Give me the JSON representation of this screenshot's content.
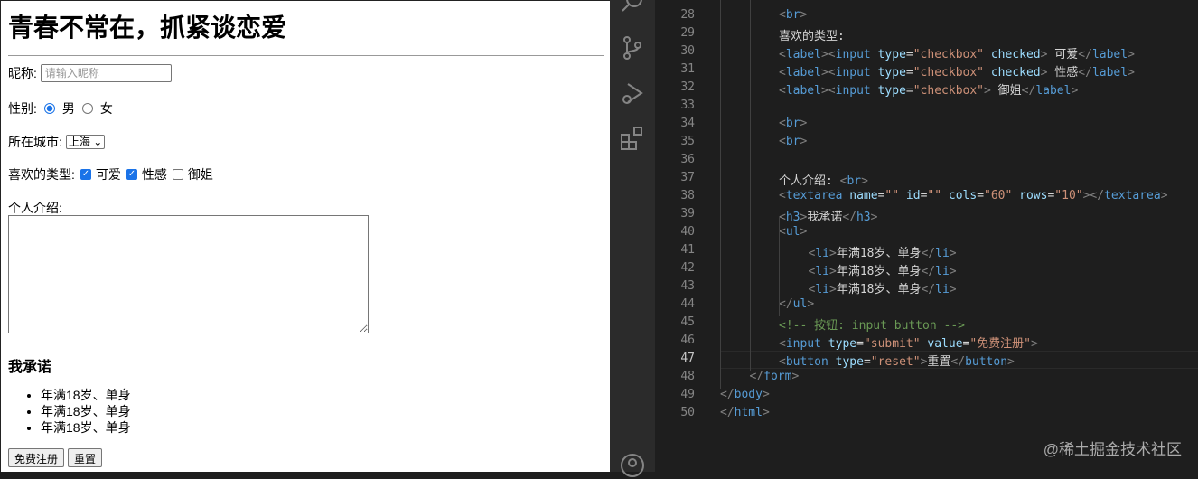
{
  "preview": {
    "title": "青春不常在，抓紧谈恋爱",
    "nickname_label": "昵称:",
    "nickname_placeholder": "请输入昵称",
    "gender_label": "性别:",
    "gender_options": [
      "男",
      "女"
    ],
    "gender_selected": "男",
    "city_label": "所在城市:",
    "city_value": "上海",
    "type_label": "喜欢的类型:",
    "types": [
      {
        "label": "可爱",
        "checked": true
      },
      {
        "label": "性感",
        "checked": true
      },
      {
        "label": "御姐",
        "checked": false
      }
    ],
    "intro_label": "个人介绍:",
    "promise_heading": "我承诺",
    "promises": [
      "年满18岁、单身",
      "年满18岁、单身",
      "年满18岁、单身"
    ],
    "submit_label": "免费注册",
    "reset_label": "重置"
  },
  "editor": {
    "current_line": 47,
    "lines": [
      {
        "n": 28,
        "indent": 2,
        "tokens": [
          [
            "p",
            "<"
          ],
          [
            "t",
            "br"
          ],
          [
            "p",
            ">"
          ]
        ]
      },
      {
        "n": 29,
        "indent": 2,
        "tokens": [
          [
            "x",
            "喜欢的类型:"
          ]
        ]
      },
      {
        "n": 30,
        "indent": 2,
        "tokens": [
          [
            "p",
            "<"
          ],
          [
            "t",
            "label"
          ],
          [
            "p",
            "><"
          ],
          [
            "t",
            "input"
          ],
          [
            "x",
            " "
          ],
          [
            "a",
            "type"
          ],
          [
            "x",
            "="
          ],
          [
            "s",
            "\"checkbox\""
          ],
          [
            "x",
            " "
          ],
          [
            "a",
            "checked"
          ],
          [
            "p",
            ">"
          ],
          [
            "x",
            " 可爱"
          ],
          [
            "p",
            "</"
          ],
          [
            "t",
            "label"
          ],
          [
            "p",
            ">"
          ]
        ]
      },
      {
        "n": 31,
        "indent": 2,
        "tokens": [
          [
            "p",
            "<"
          ],
          [
            "t",
            "label"
          ],
          [
            "p",
            "><"
          ],
          [
            "t",
            "input"
          ],
          [
            "x",
            " "
          ],
          [
            "a",
            "type"
          ],
          [
            "x",
            "="
          ],
          [
            "s",
            "\"checkbox\""
          ],
          [
            "x",
            " "
          ],
          [
            "a",
            "checked"
          ],
          [
            "p",
            ">"
          ],
          [
            "x",
            " 性感"
          ],
          [
            "p",
            "</"
          ],
          [
            "t",
            "label"
          ],
          [
            "p",
            ">"
          ]
        ]
      },
      {
        "n": 32,
        "indent": 2,
        "tokens": [
          [
            "p",
            "<"
          ],
          [
            "t",
            "label"
          ],
          [
            "p",
            "><"
          ],
          [
            "t",
            "input"
          ],
          [
            "x",
            " "
          ],
          [
            "a",
            "type"
          ],
          [
            "x",
            "="
          ],
          [
            "s",
            "\"checkbox\""
          ],
          [
            "p",
            ">"
          ],
          [
            "x",
            " 御姐"
          ],
          [
            "p",
            "</"
          ],
          [
            "t",
            "label"
          ],
          [
            "p",
            ">"
          ]
        ]
      },
      {
        "n": 33,
        "indent": 2,
        "tokens": []
      },
      {
        "n": 34,
        "indent": 2,
        "tokens": [
          [
            "p",
            "<"
          ],
          [
            "t",
            "br"
          ],
          [
            "p",
            ">"
          ]
        ]
      },
      {
        "n": 35,
        "indent": 2,
        "tokens": [
          [
            "p",
            "<"
          ],
          [
            "t",
            "br"
          ],
          [
            "p",
            ">"
          ]
        ]
      },
      {
        "n": 36,
        "indent": 2,
        "tokens": []
      },
      {
        "n": 37,
        "indent": 2,
        "tokens": [
          [
            "x",
            "个人介绍: "
          ],
          [
            "p",
            "<"
          ],
          [
            "t",
            "br"
          ],
          [
            "p",
            ">"
          ]
        ]
      },
      {
        "n": 38,
        "indent": 2,
        "tokens": [
          [
            "p",
            "<"
          ],
          [
            "t",
            "textarea"
          ],
          [
            "x",
            " "
          ],
          [
            "a",
            "name"
          ],
          [
            "x",
            "="
          ],
          [
            "s",
            "\"\""
          ],
          [
            "x",
            " "
          ],
          [
            "a",
            "id"
          ],
          [
            "x",
            "="
          ],
          [
            "s",
            "\"\""
          ],
          [
            "x",
            " "
          ],
          [
            "a",
            "cols"
          ],
          [
            "x",
            "="
          ],
          [
            "s",
            "\"60\""
          ],
          [
            "x",
            " "
          ],
          [
            "a",
            "rows"
          ],
          [
            "x",
            "="
          ],
          [
            "s",
            "\"10\""
          ],
          [
            "p",
            "></"
          ],
          [
            "t",
            "textarea"
          ],
          [
            "p",
            ">"
          ]
        ]
      },
      {
        "n": 39,
        "indent": 2,
        "tokens": [
          [
            "p",
            "<"
          ],
          [
            "t",
            "h3"
          ],
          [
            "p",
            ">"
          ],
          [
            "x",
            "我承诺"
          ],
          [
            "p",
            "</"
          ],
          [
            "t",
            "h3"
          ],
          [
            "p",
            ">"
          ]
        ]
      },
      {
        "n": 40,
        "indent": 2,
        "tokens": [
          [
            "p",
            "<"
          ],
          [
            "t",
            "ul"
          ],
          [
            "p",
            ">"
          ]
        ]
      },
      {
        "n": 41,
        "indent": 3,
        "tokens": [
          [
            "p",
            "<"
          ],
          [
            "t",
            "li"
          ],
          [
            "p",
            ">"
          ],
          [
            "x",
            "年满18岁、单身"
          ],
          [
            "p",
            "</"
          ],
          [
            "t",
            "li"
          ],
          [
            "p",
            ">"
          ]
        ]
      },
      {
        "n": 42,
        "indent": 3,
        "tokens": [
          [
            "p",
            "<"
          ],
          [
            "t",
            "li"
          ],
          [
            "p",
            ">"
          ],
          [
            "x",
            "年满18岁、单身"
          ],
          [
            "p",
            "</"
          ],
          [
            "t",
            "li"
          ],
          [
            "p",
            ">"
          ]
        ]
      },
      {
        "n": 43,
        "indent": 3,
        "tokens": [
          [
            "p",
            "<"
          ],
          [
            "t",
            "li"
          ],
          [
            "p",
            ">"
          ],
          [
            "x",
            "年满18岁、单身"
          ],
          [
            "p",
            "</"
          ],
          [
            "t",
            "li"
          ],
          [
            "p",
            ">"
          ]
        ]
      },
      {
        "n": 44,
        "indent": 2,
        "tokens": [
          [
            "p",
            "</"
          ],
          [
            "t",
            "ul"
          ],
          [
            "p",
            ">"
          ]
        ]
      },
      {
        "n": 45,
        "indent": 2,
        "tokens": [
          [
            "c",
            "<!-- 按钮: input button -->"
          ]
        ]
      },
      {
        "n": 46,
        "indent": 2,
        "tokens": [
          [
            "p",
            "<"
          ],
          [
            "t",
            "input"
          ],
          [
            "x",
            " "
          ],
          [
            "a",
            "type"
          ],
          [
            "x",
            "="
          ],
          [
            "s",
            "\"submit\""
          ],
          [
            "x",
            " "
          ],
          [
            "a",
            "value"
          ],
          [
            "x",
            "="
          ],
          [
            "s",
            "\"免费注册\""
          ],
          [
            "p",
            ">"
          ]
        ]
      },
      {
        "n": 47,
        "indent": 2,
        "tokens": [
          [
            "p",
            "<"
          ],
          [
            "t",
            "button"
          ],
          [
            "x",
            " "
          ],
          [
            "a",
            "type"
          ],
          [
            "x",
            "="
          ],
          [
            "s",
            "\"reset\""
          ],
          [
            "p",
            ">"
          ],
          [
            "x",
            "重置"
          ],
          [
            "p",
            "</"
          ],
          [
            "t",
            "button"
          ],
          [
            "p",
            ">"
          ]
        ]
      },
      {
        "n": 48,
        "indent": 1,
        "tokens": [
          [
            "p",
            "</"
          ],
          [
            "t",
            "form"
          ],
          [
            "p",
            ">"
          ]
        ]
      },
      {
        "n": 49,
        "indent": 0,
        "tokens": [
          [
            "p",
            "</"
          ],
          [
            "t",
            "body"
          ],
          [
            "p",
            ">"
          ]
        ]
      },
      {
        "n": 50,
        "indent": 0,
        "tokens": [
          [
            "p",
            "</"
          ],
          [
            "t",
            "html"
          ],
          [
            "p",
            ">"
          ]
        ]
      }
    ]
  },
  "watermark": "@稀土掘金技术社区"
}
